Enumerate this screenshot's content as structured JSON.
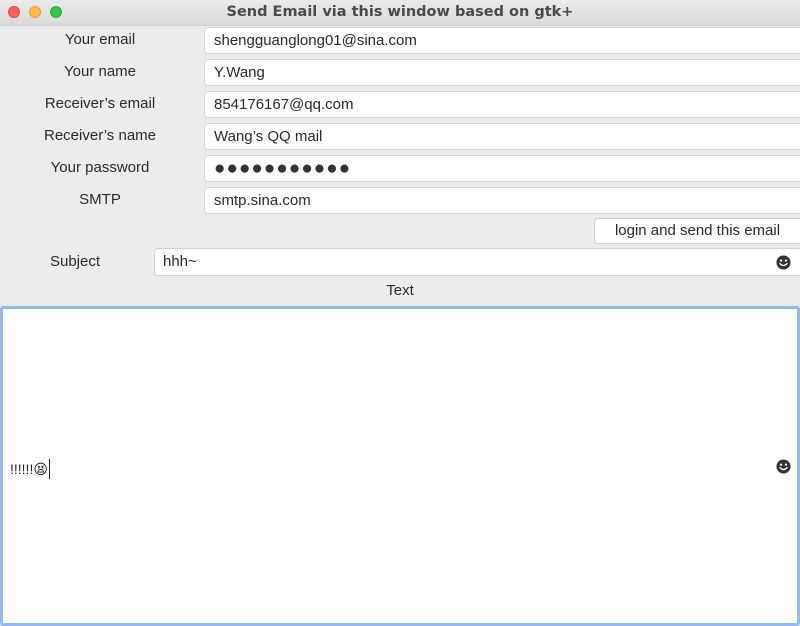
{
  "window": {
    "title": "Send Email via this window based on gtk+"
  },
  "form": {
    "your_email": {
      "label": "Your email",
      "value": "shengguanglong01@sina.com"
    },
    "your_name": {
      "label": "Your name",
      "value": "Y.Wang"
    },
    "receiver_email": {
      "label": "Receiver’s email",
      "value": "854176167@qq.com"
    },
    "receiver_name": {
      "label": "Receiver’s name",
      "value": "Wang’s QQ mail"
    },
    "password": {
      "label": "Your password",
      "masked_value": "●●●●●●●●●●●"
    },
    "smtp": {
      "label": "SMTP",
      "value": "smtp.sina.com"
    }
  },
  "send_button": {
    "label": "login and send this email"
  },
  "subject": {
    "label": "Subject",
    "value": "hhh~"
  },
  "text": {
    "label": "Text",
    "value": "!!!!!!😫"
  },
  "icons": {
    "subject_emoji": "smiley-face-icon",
    "text_emoji": "smiley-face-icon"
  },
  "colors": {
    "focus_border": "#94b8ef",
    "close": "#fc605c",
    "minimize": "#fdbc40",
    "maximize": "#34c84a"
  }
}
